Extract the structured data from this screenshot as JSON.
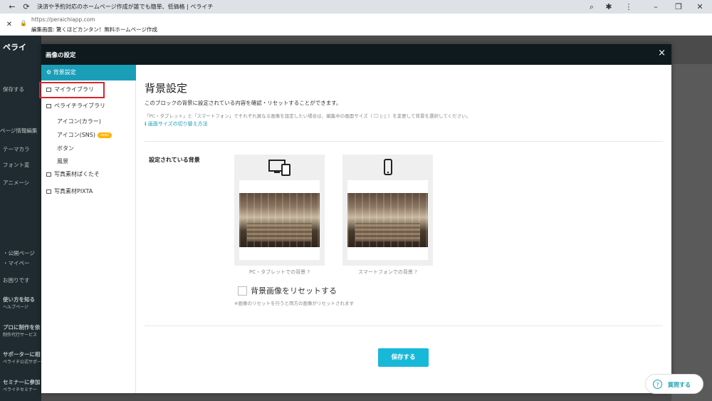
{
  "browser": {
    "tab_title": "決済や予約対応のホームページ作成が誰でも簡単、低価格 | ペライチ",
    "url": "https://peraichiapp.com",
    "page_subtitle": "編集画面: 驚くほどカンタン！無料ホームページ作成"
  },
  "bg_sidebar": {
    "logo": "ペライ",
    "save": "保存する",
    "page_edit": "ページ情報編集",
    "theme_color": "テーマカラ",
    "font": "フォント変",
    "animation": "アニメーシ",
    "public_page": "・公開ページ",
    "my_page": "・マイペー",
    "help": "お困りです",
    "howto": "使い方を知る",
    "howto_sub": "ヘルプページ",
    "pro": "プロに制作を依",
    "pro_sub": "制作代行サービス",
    "supporter": "サポーターに相",
    "supporter_sub": "ペライチ公式サポー",
    "seminar": "セミナーに参加",
    "seminar_sub": "ペライチセミナー"
  },
  "modal": {
    "title": "画像の設定",
    "close": "×"
  },
  "sidebar": {
    "items": [
      {
        "label": "背景設定"
      },
      {
        "label": "マイライブラリ"
      },
      {
        "label": "ペライチライブラリ"
      },
      {
        "label": "写真素材ぱくたそ"
      },
      {
        "label": "写真素材PIXTA"
      }
    ],
    "sub_items": [
      {
        "label": "アイコン(カラー)"
      },
      {
        "label": "アイコン(SNS)",
        "badge": "new!"
      },
      {
        "label": "ボタン"
      },
      {
        "label": "風景"
      }
    ]
  },
  "main": {
    "title": "背景設定",
    "desc": "このブロックの背景に設定されている内容を確認・リセットすることができます。",
    "note": "「PC・タブレット」と「スマートフォン」でそれぞれ異なる画像を設定したい場合は、編集中の画面サイズ（ 🖵 ▯ ▯ ）を変更して背景を選択してください。",
    "switch_link": "画面サイズの切り替え方法",
    "set_label": "設定されている背景",
    "pc_caption": "PC・タブレットでの背景",
    "sp_caption": "スマートフォンでの背景",
    "reset_label": "背景画像をリセットする",
    "reset_note": "※画像のリセットを行うと両方の画像がリセットされます",
    "save": "保存する"
  },
  "help_button": {
    "label": "質問する"
  },
  "colors": {
    "accent": "#1a9eb8",
    "save_button": "#18b8d9",
    "highlight": "#d9242c",
    "modal_header": "#0e1a1e"
  },
  "icons": [
    "back-icon",
    "reload-icon",
    "lock-icon",
    "search-icon",
    "extension-icon",
    "menu-icon",
    "gear-icon",
    "image-icon",
    "devices-icon",
    "smartphone-icon",
    "help-icon",
    "close-icon"
  ]
}
